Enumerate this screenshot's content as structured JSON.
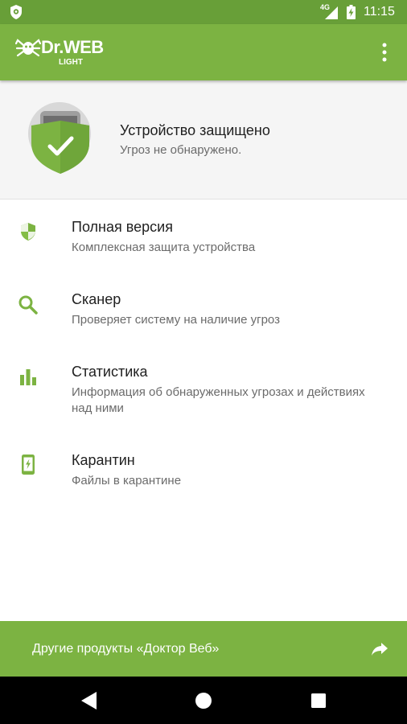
{
  "status_bar": {
    "network": "4G",
    "time": "11:15"
  },
  "app_bar": {
    "logo_text": "Dr.WEB",
    "logo_subtext": "LIGHT"
  },
  "protection": {
    "title": "Устройство защищено",
    "subtitle": "Угроз не обнаружено."
  },
  "menu": [
    {
      "icon": "shield-icon",
      "title": "Полная версия",
      "subtitle": "Комплексная защита устройства"
    },
    {
      "icon": "search-icon",
      "title": "Сканер",
      "subtitle": "Проверяет систему на наличие угроз"
    },
    {
      "icon": "bar-chart-icon",
      "title": "Статистика",
      "subtitle": "Информация об обнаруженных угрозах и действиях над ними"
    },
    {
      "icon": "phone-quarantine-icon",
      "title": "Карантин",
      "subtitle": "Файлы в карантине"
    }
  ],
  "bottom_bar": {
    "label": "Другие продукты «Доктор Веб»",
    "icon": "share-forward-icon"
  },
  "colors": {
    "accent": "#7cb342",
    "status_bar": "#689f38",
    "shield": "#7cb342"
  }
}
